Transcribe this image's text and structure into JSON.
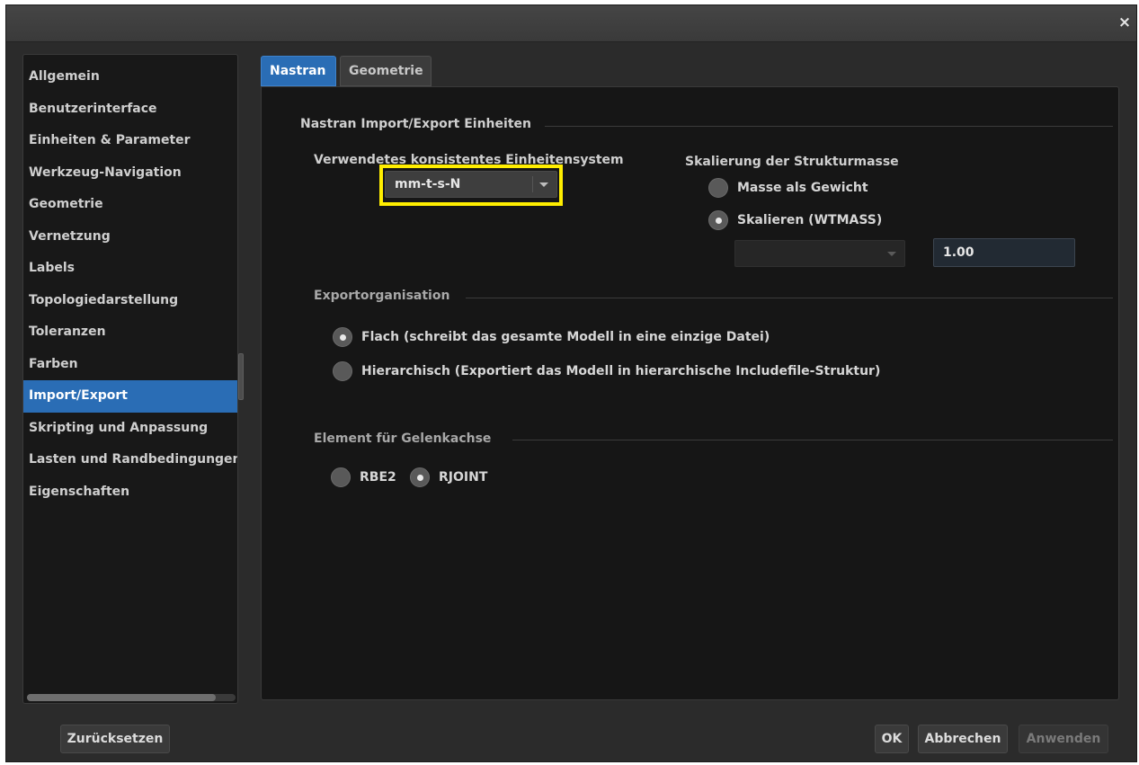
{
  "window": {
    "close_glyph": "×"
  },
  "sidebar": {
    "items": [
      {
        "label": "Allgemein"
      },
      {
        "label": "Benutzerinterface"
      },
      {
        "label": "Einheiten & Parameter"
      },
      {
        "label": "Werkzeug-Navigation"
      },
      {
        "label": "Geometrie"
      },
      {
        "label": "Vernetzung"
      },
      {
        "label": "Labels"
      },
      {
        "label": "Topologiedarstellung"
      },
      {
        "label": "Toleranzen"
      },
      {
        "label": "Farben"
      },
      {
        "label": "Import/Export",
        "active": true
      },
      {
        "label": "Skripting und Anpassung"
      },
      {
        "label": "Lasten und Randbedingungen"
      },
      {
        "label": "Eigenschaften"
      }
    ]
  },
  "tabs": [
    {
      "label": "Nastran",
      "active": true
    },
    {
      "label": "Geometrie",
      "active": false
    }
  ],
  "units_section": {
    "title": "Nastran Import/Export Einheiten",
    "unit_system_label": "Verwendetes konsistentes Einheitensystem",
    "unit_system_value": "mm-t-s-N",
    "mass_scaling_label": "Skalierung der Strukturmasse",
    "mass_as_weight_label": "Masse als Gewicht",
    "mass_as_weight_checked": false,
    "scale_wtmass_label": "Skalieren (WTMASS)",
    "scale_wtmass_checked": true,
    "wtmass_combo_value": "",
    "wtmass_value": "1.00"
  },
  "export_section": {
    "title": "Exportorganisation",
    "flat_label": "Flach (schreibt das gesamte Modell in eine einzige Datei)",
    "flat_checked": true,
    "hierarchical_label": "Hierarchisch (Exportiert das Modell in hierarchische Includefile-Struktur)",
    "hierarchical_checked": false
  },
  "joint_section": {
    "title": "Element für Gelenkachse",
    "rbe2_label": "RBE2",
    "rbe2_checked": false,
    "rjoint_label": "RJOINT",
    "rjoint_checked": true
  },
  "footer": {
    "reset_label": "Zurücksetzen",
    "ok_label": "OK",
    "cancel_label": "Abbrechen",
    "apply_label": "Anwenden"
  },
  "colors": {
    "accent": "#2a6db5",
    "highlight": "#ffee00",
    "background": "#2b2b2b",
    "panel": "#161616"
  }
}
